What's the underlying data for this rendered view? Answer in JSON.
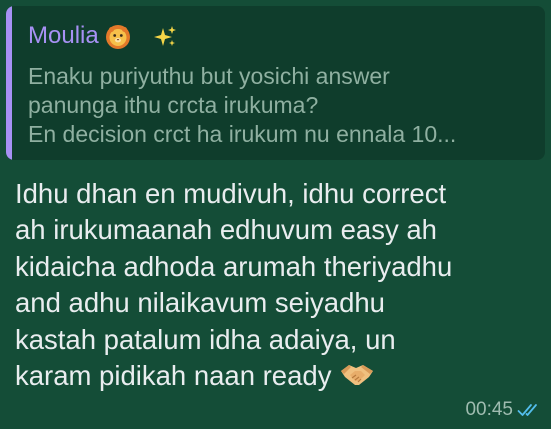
{
  "colors": {
    "bubble_bg": "#144d37",
    "quote_bg": "#0f3d2c",
    "quote_accent": "#a791f4",
    "quote_text": "#8fb0a1",
    "message_text": "#e9edef",
    "meta_text": "#9fbcb0",
    "read_ticks": "#53bdeb"
  },
  "quoted": {
    "author": "Moulia",
    "author_icons": [
      "lion-face-icon",
      "sparkles-icon"
    ],
    "lines": [
      "Enaku puriyuthu but yosichi answer",
      "panunga ithu crcta irukuma?",
      "En decision crct ha irukum nu ennala 10..."
    ]
  },
  "message": {
    "lines": [
      "Idhu dhan en mudivuh, idhu correct",
      "ah irukumaanah edhuvum easy ah",
      "kidaicha adhoda arumah theriyadhu",
      "and adhu nilaikavum seiyadhu",
      "kastah patalum idha adaiya, un",
      "karam pidikah naan ready"
    ],
    "trailing_icon": "handshake-icon"
  },
  "meta": {
    "time": "00:45",
    "status_icon": "double-check-read-icon"
  }
}
